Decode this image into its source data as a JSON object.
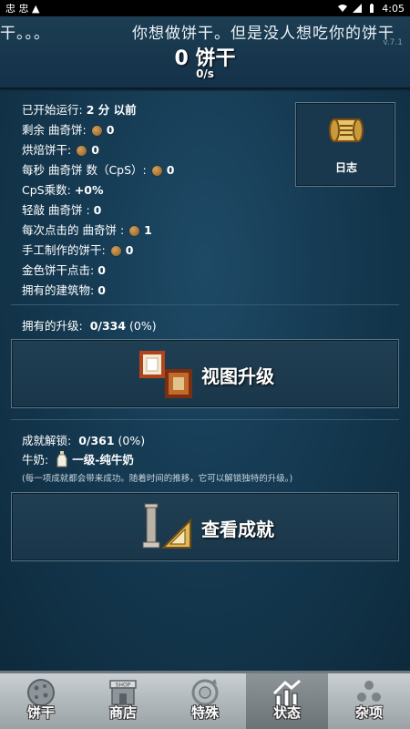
{
  "status_bar": {
    "left_text": "忠 忠 ▲",
    "time": "4:05"
  },
  "header": {
    "ticker_left": "干。。。",
    "ticker_right": "你想做饼干。但是没人想吃你的饼干",
    "version": "v.7.1",
    "cookies": "0 饼干",
    "cps": "0/s"
  },
  "stats": {
    "lines": [
      {
        "label": "已开始运行:",
        "value": "2 分 以前",
        "cookie": false
      },
      {
        "label": "剩余 曲奇饼:",
        "value": "0",
        "cookie": true
      },
      {
        "label": "烘焙饼干:",
        "value": "0",
        "cookie": true
      },
      {
        "label": "每秒 曲奇饼 数（CpS）:",
        "value": "0",
        "cookie": true
      },
      {
        "label": "CpS乘数:",
        "value": "+0%",
        "cookie": false
      },
      {
        "label": "轻敲 曲奇饼 :",
        "value": "0",
        "cookie": false
      },
      {
        "label": "每次点击的 曲奇饼 :",
        "value": "1",
        "cookie": true
      },
      {
        "label": "手工制作的饼干:",
        "value": "0",
        "cookie": true
      },
      {
        "label": "金色饼干点击:",
        "value": "0",
        "cookie": false
      },
      {
        "label": "拥有的建筑物:",
        "value": "0",
        "cookie": false
      }
    ]
  },
  "log_button": {
    "label": "日志",
    "icon": "scroll-icon"
  },
  "upgrades": {
    "label": "拥有的升级:",
    "value": "0/334",
    "percent": "(0%)",
    "button_label": "视图升级",
    "button_icon": "upgrade-frames-icon"
  },
  "achievements": {
    "label": "成就解锁:",
    "value": "0/361",
    "percent": "(0%)",
    "milk_label": "牛奶:",
    "milk_name": "一级-纯牛奶",
    "note": "(每一项成就都会带来成功。随着时间的推移，它可以解锁独特的升级。)",
    "button_label": "查看成就",
    "button_icon": "trophy-pillar-icon"
  },
  "tabs": [
    {
      "label": "饼干",
      "icon": "cookie-icon",
      "active": false
    },
    {
      "label": "商店",
      "icon": "shop-icon",
      "active": false
    },
    {
      "label": "特殊",
      "icon": "special-icon",
      "active": false
    },
    {
      "label": "状态",
      "icon": "stats-icon",
      "active": true
    },
    {
      "label": "杂项",
      "icon": "misc-icon",
      "active": false
    }
  ],
  "colors": {
    "background": "#153a52",
    "panel_border": "#5c7787",
    "tabbar": "#b3babd"
  }
}
